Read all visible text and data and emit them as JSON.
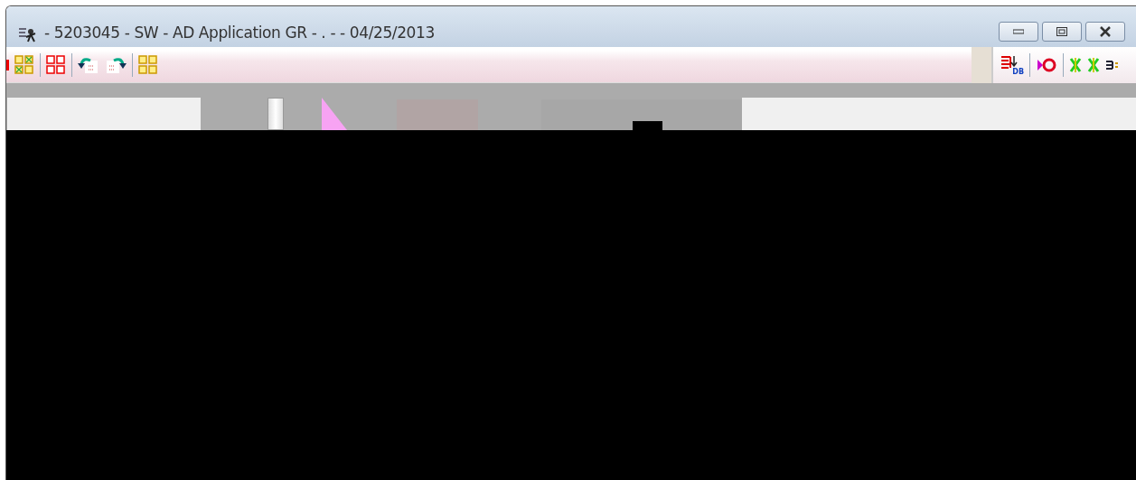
{
  "window": {
    "title": "- 5203045 - SW - AD Application GR - . - - 04/25/2013"
  },
  "right_toolbar": {
    "db_badge": "DB"
  }
}
